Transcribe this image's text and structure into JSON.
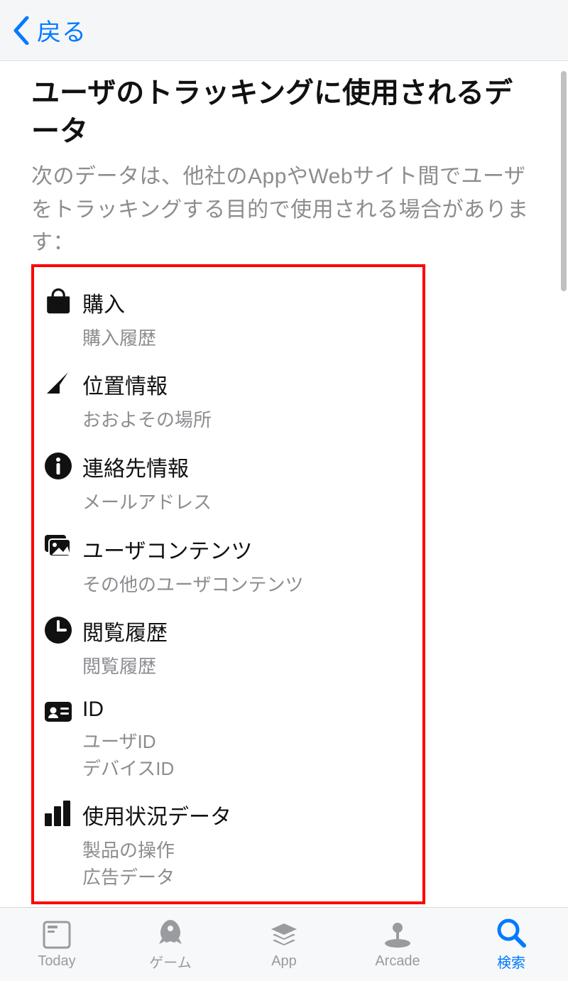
{
  "nav": {
    "back_label": "戻る"
  },
  "main": {
    "title": "ユーザのトラッキングに使用されるデータ",
    "description": "次のデータは、他社のAppやWebサイト間でユーザをトラッキングする目的で使用される場合があります：",
    "items": [
      {
        "icon": "bag-icon",
        "title": "購入",
        "subs": [
          "購入履歴"
        ]
      },
      {
        "icon": "location-icon",
        "title": "位置情報",
        "subs": [
          "おおよその場所"
        ]
      },
      {
        "icon": "info-icon",
        "title": "連絡先情報",
        "subs": [
          "メールアドレス"
        ]
      },
      {
        "icon": "photo-icon",
        "title": "ユーザコンテンツ",
        "subs": [
          "その他のユーザコンテンツ"
        ]
      },
      {
        "icon": "clock-icon",
        "title": "閲覧履歴",
        "subs": [
          "閲覧履歴"
        ]
      },
      {
        "icon": "id-icon",
        "title": "ID",
        "subs": [
          "ユーザID",
          "デバイスID"
        ]
      },
      {
        "icon": "chart-icon",
        "title": "使用状況データ",
        "subs": [
          "製品の操作",
          "広告データ"
        ]
      }
    ]
  },
  "tabs": [
    {
      "icon": "today-icon",
      "label": "Today",
      "active": false
    },
    {
      "icon": "rocket-icon",
      "label": "ゲーム",
      "active": false
    },
    {
      "icon": "layers-icon",
      "label": "App",
      "active": false
    },
    {
      "icon": "joystick-icon",
      "label": "Arcade",
      "active": false
    },
    {
      "icon": "search-icon",
      "label": "検索",
      "active": true
    }
  ],
  "colors": {
    "accent": "#007aff",
    "highlight_border": "#ff0000"
  }
}
